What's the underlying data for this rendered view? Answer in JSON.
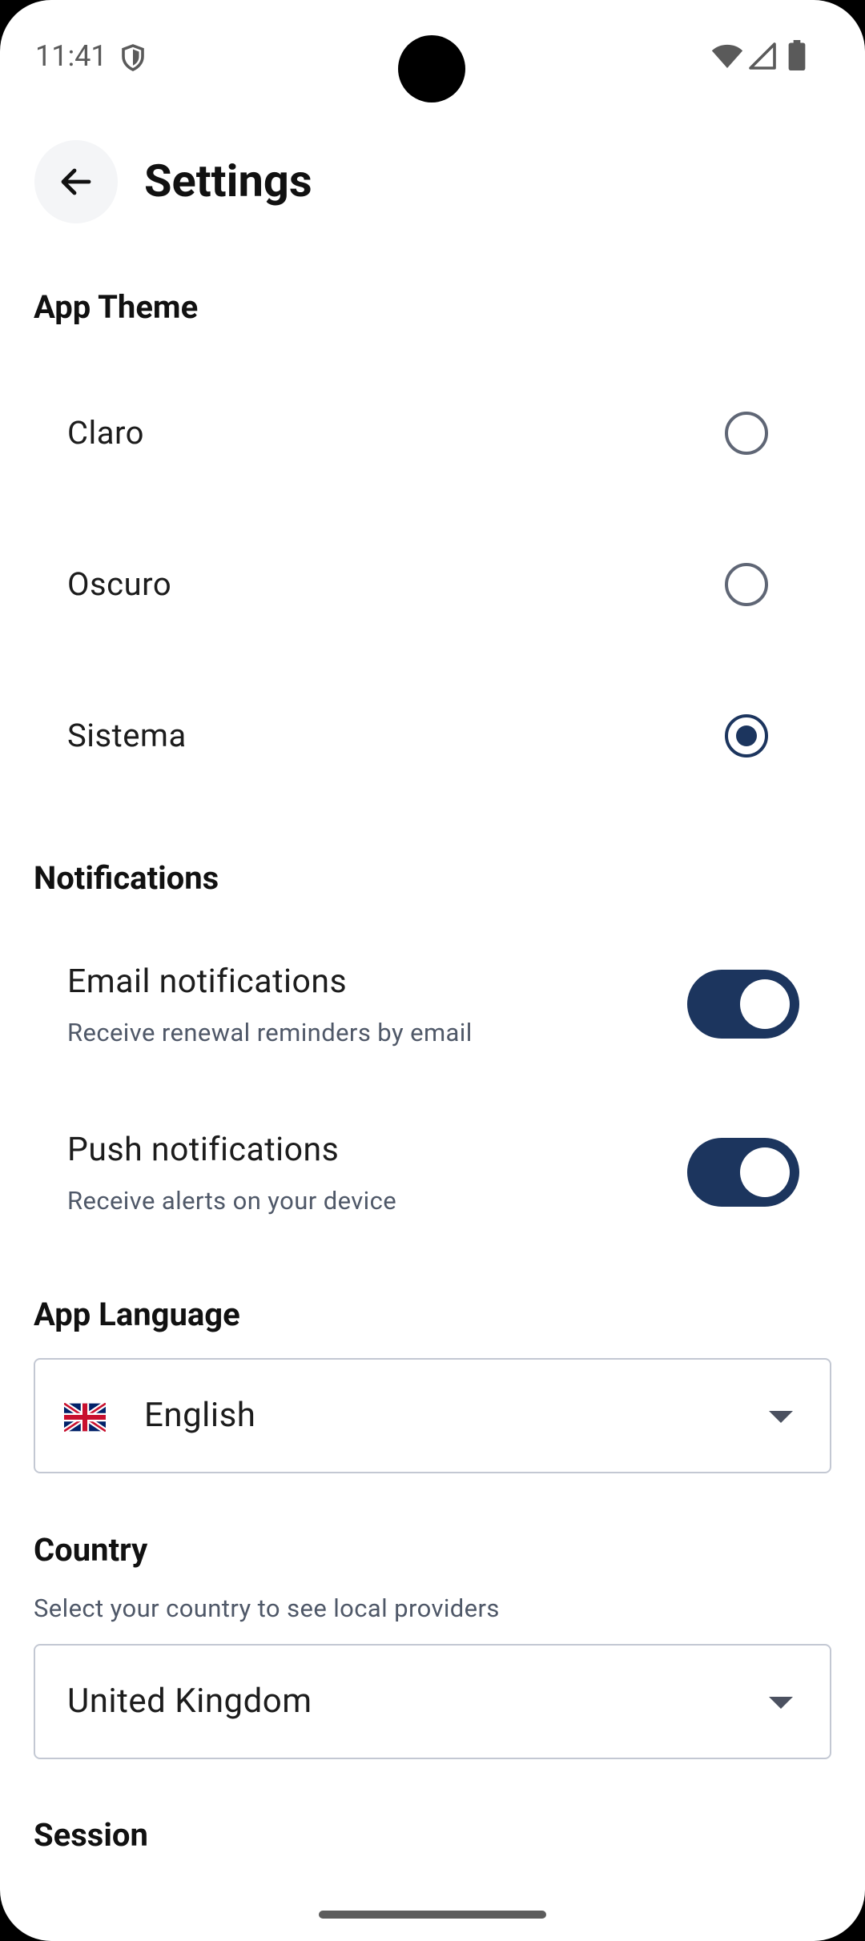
{
  "status_bar": {
    "time": "11:41"
  },
  "header": {
    "title": "Settings"
  },
  "theme": {
    "heading": "App Theme",
    "options": [
      {
        "label": "Claro",
        "selected": false
      },
      {
        "label": "Oscuro",
        "selected": false
      },
      {
        "label": "Sistema",
        "selected": true
      }
    ]
  },
  "notifications": {
    "heading": "Notifications",
    "items": [
      {
        "title": "Email notifications",
        "subtitle": "Receive renewal reminders by email",
        "enabled": true
      },
      {
        "title": "Push notifications",
        "subtitle": "Receive alerts on your device",
        "enabled": true
      }
    ]
  },
  "language": {
    "heading": "App Language",
    "selected": "English",
    "flag_icon": "uk-flag-icon"
  },
  "country": {
    "heading": "Country",
    "subtitle": "Select your country to see local providers",
    "selected": "United Kingdom"
  },
  "session": {
    "heading": "Session"
  },
  "colors": {
    "accent": "#1c355e",
    "muted": "#4f5868",
    "border": "#c3c8d3"
  }
}
